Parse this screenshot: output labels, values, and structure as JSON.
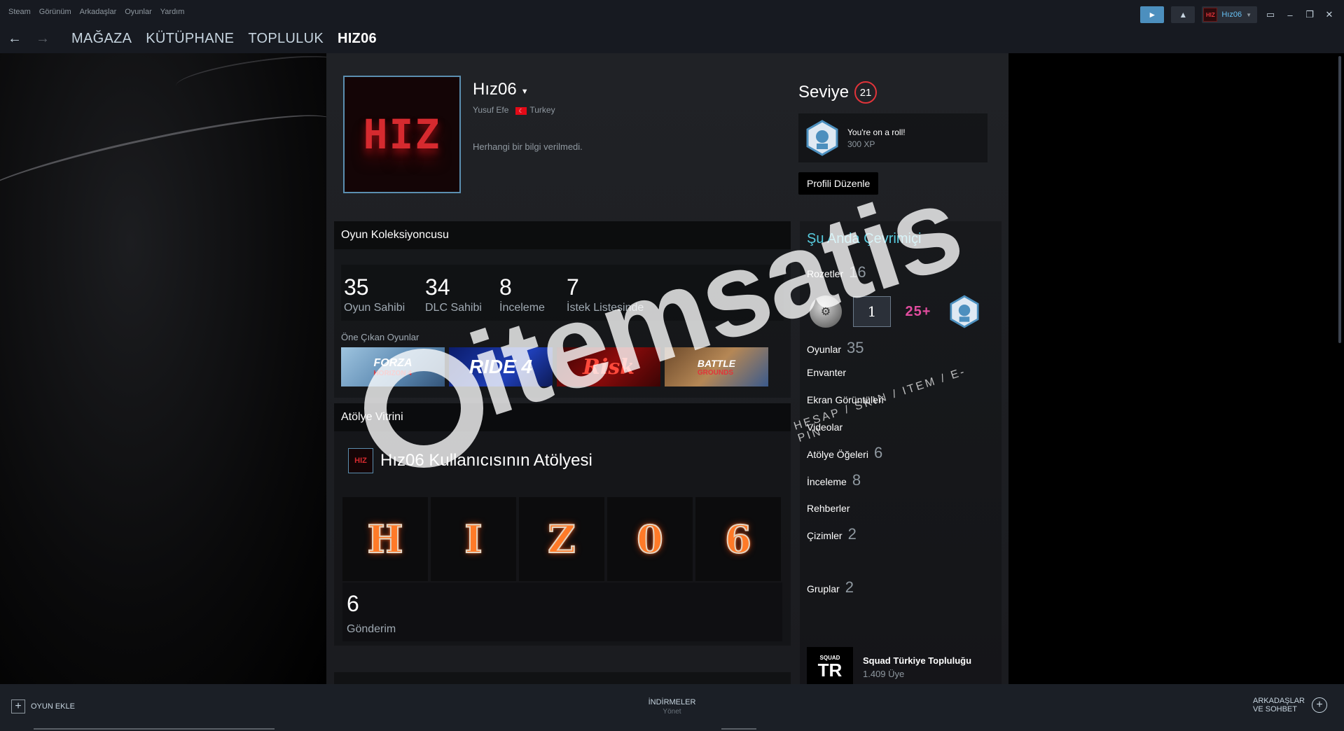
{
  "menu": [
    "Steam",
    "Görünüm",
    "Arkadaşlar",
    "Oyunlar",
    "Yardım"
  ],
  "titlebar": {
    "username": "Hız06"
  },
  "nav": {
    "links": [
      "MAĞAZA",
      "KÜTÜPHANE",
      "TOPLULUK",
      "HIZ06"
    ]
  },
  "profile": {
    "avatar_text": "HIZ",
    "persona_name": "Hız06",
    "real_name": "Yusuf Efe",
    "country": "Turkey",
    "summary": "Herhangi bir bilgi verilmedi.",
    "level_label": "Seviye",
    "level": "21",
    "badge": {
      "title": "You're on a roll!",
      "xp": "300 XP"
    },
    "edit_button": "Profili Düzenle"
  },
  "collector": {
    "title": "Oyun Koleksiyoncusu",
    "stats": [
      {
        "num": "35",
        "label": "Oyun Sahibi"
      },
      {
        "num": "34",
        "label": "DLC Sahibi"
      },
      {
        "num": "8",
        "label": "İnceleme"
      },
      {
        "num": "7",
        "label": "İstek Listesinde"
      }
    ],
    "featured_label": "Öne Çıkan Oyunlar",
    "games": [
      {
        "title": "FORZA",
        "sub": "HORIZON 4"
      },
      {
        "title": "RIDE 4"
      },
      {
        "title": "Risk"
      },
      {
        "title": "BATTLE",
        "sub": "GROUNDS"
      }
    ]
  },
  "workshop": {
    "title": "Atölye Vitrini",
    "heading": "Hız06 Kullanıcısının Atölyesi",
    "tiles": [
      "H",
      "I",
      "Z",
      "0",
      "6"
    ],
    "count": "6",
    "count_label": "Gönderim"
  },
  "sidebar": {
    "online": "Şu Anda Çevrimiçi",
    "badges_label": "Rozetler",
    "badges_count": "16",
    "badge_dark_num": "1",
    "badge_pink": "25+",
    "items": [
      {
        "label": "Oyunlar",
        "count": "35"
      },
      {
        "label": "Envanter",
        "count": ""
      },
      {
        "label": "Ekran Görüntüleri",
        "count": ""
      },
      {
        "label": "Videolar",
        "count": ""
      },
      {
        "label": "Atölye Öğeleri",
        "count": "6"
      },
      {
        "label": "İnceleme",
        "count": "8"
      },
      {
        "label": "Rehberler",
        "count": ""
      },
      {
        "label": "Çizimler",
        "count": "2"
      }
    ],
    "groups_label": "Gruplar",
    "groups_count": "2",
    "group": {
      "logo_top": "SQUAD",
      "logo_main": "TR",
      "name": "Squad Türkiye Topluluğu",
      "members": "1.409 Üye"
    }
  },
  "watermark": {
    "text": "itemsatis",
    "tag": "HESAP / SKIN / ITEM / E-PIN"
  },
  "bottom": {
    "add_game": "OYUN EKLE",
    "downloads": "İNDİRMELER",
    "downloads_sub": "Yönet",
    "friends_line1": "ARKADAŞLAR",
    "friends_line2": "VE SOHBET"
  },
  "colors": {
    "accent_blue": "#4c8fbe",
    "online_teal": "#57cbde",
    "level_red": "#e0343a"
  }
}
